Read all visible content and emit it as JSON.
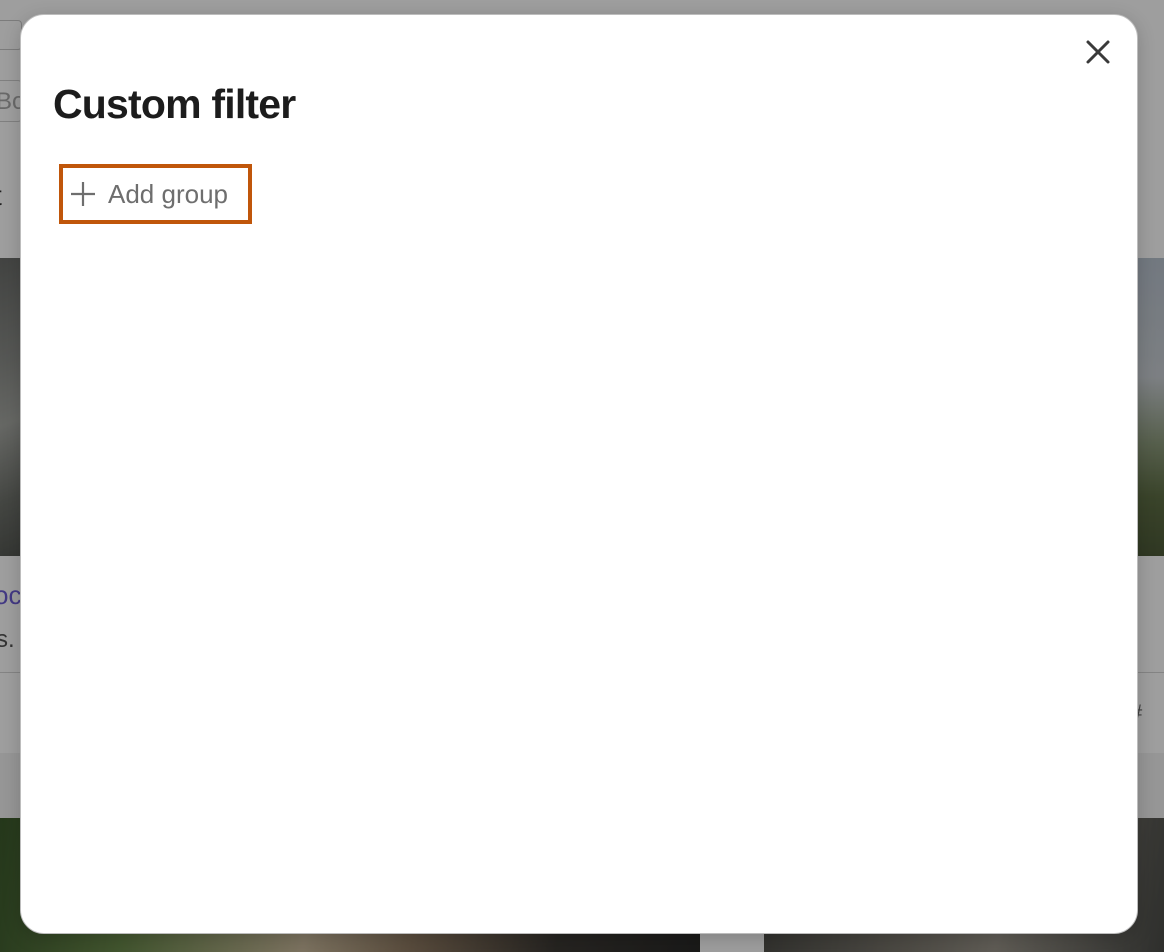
{
  "background": {
    "search_fragment": "Bo",
    "heading_fragment": "t",
    "link_fragment": "oc",
    "text_fragment": "s.",
    "footer_fragment": "#"
  },
  "modal": {
    "title": "Custom filter",
    "close_icon": "close-icon",
    "add_group": {
      "label": "Add group",
      "icon": "plus-icon",
      "highlight_color": "#c0560a"
    }
  },
  "colors": {
    "title": "#1c1c1c",
    "button_text": "#6e6e6e",
    "link": "#6c5cd6"
  }
}
